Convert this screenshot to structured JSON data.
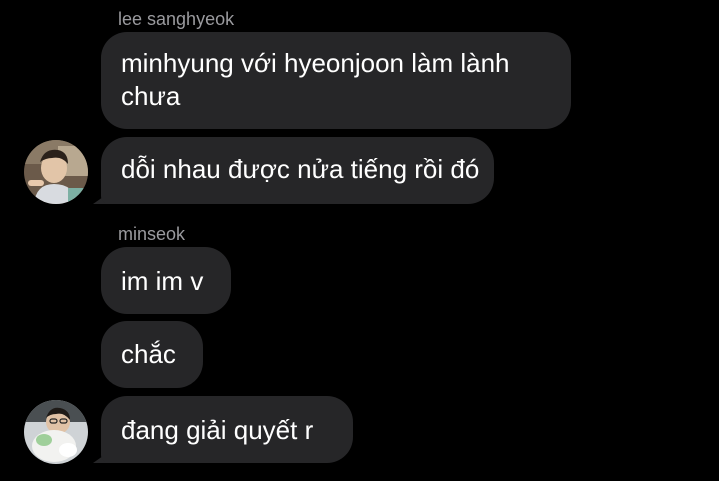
{
  "messages": [
    {
      "sender": "lee sanghyeok",
      "lines": [
        "minhyung với hyeonjoon làm lành",
        "chưa"
      ]
    },
    {
      "lines": [
        "dỗi nhau được nửa tiếng rồi đó"
      ]
    },
    {
      "sender": "minseok",
      "lines": [
        "im im v"
      ]
    },
    {
      "lines": [
        "chắc"
      ]
    },
    {
      "lines": [
        "đang giải quyết r"
      ]
    }
  ],
  "avatars": [
    {
      "icon": "profile-photo-icon"
    },
    {
      "icon": "profile-photo-icon"
    }
  ],
  "colors": {
    "background": "#000000",
    "bubble": "#262628",
    "sender_name": "#9a9a9e",
    "message_text": "#ffffff"
  }
}
